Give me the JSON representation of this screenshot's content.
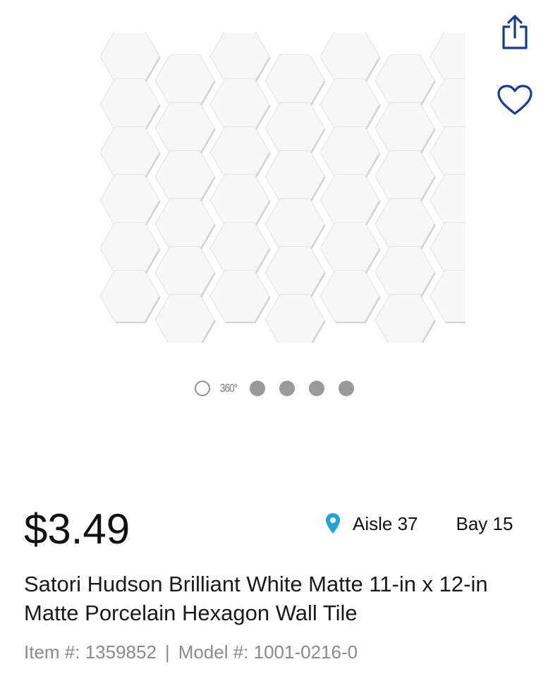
{
  "product": {
    "image_icon": "hexagon-tile-sheet",
    "price": "$3.49",
    "title": "Satori Hudson Brilliant White Matte 11-in x 12-in Matte Porcelain Hexagon Wall Tile",
    "item_label": "Item #: 1359852",
    "separator": "|",
    "model_label": "Model #: 1001-0216-0"
  },
  "actions": {
    "share_icon": "share-icon",
    "favorite_icon": "heart-icon",
    "accent_color": "#1a3a8f"
  },
  "carousel": {
    "label_360": "360°",
    "dot_count": 4
  },
  "location": {
    "pin_color": "#1ea7d6",
    "aisle": "Aisle 37",
    "bay": "Bay 15"
  }
}
